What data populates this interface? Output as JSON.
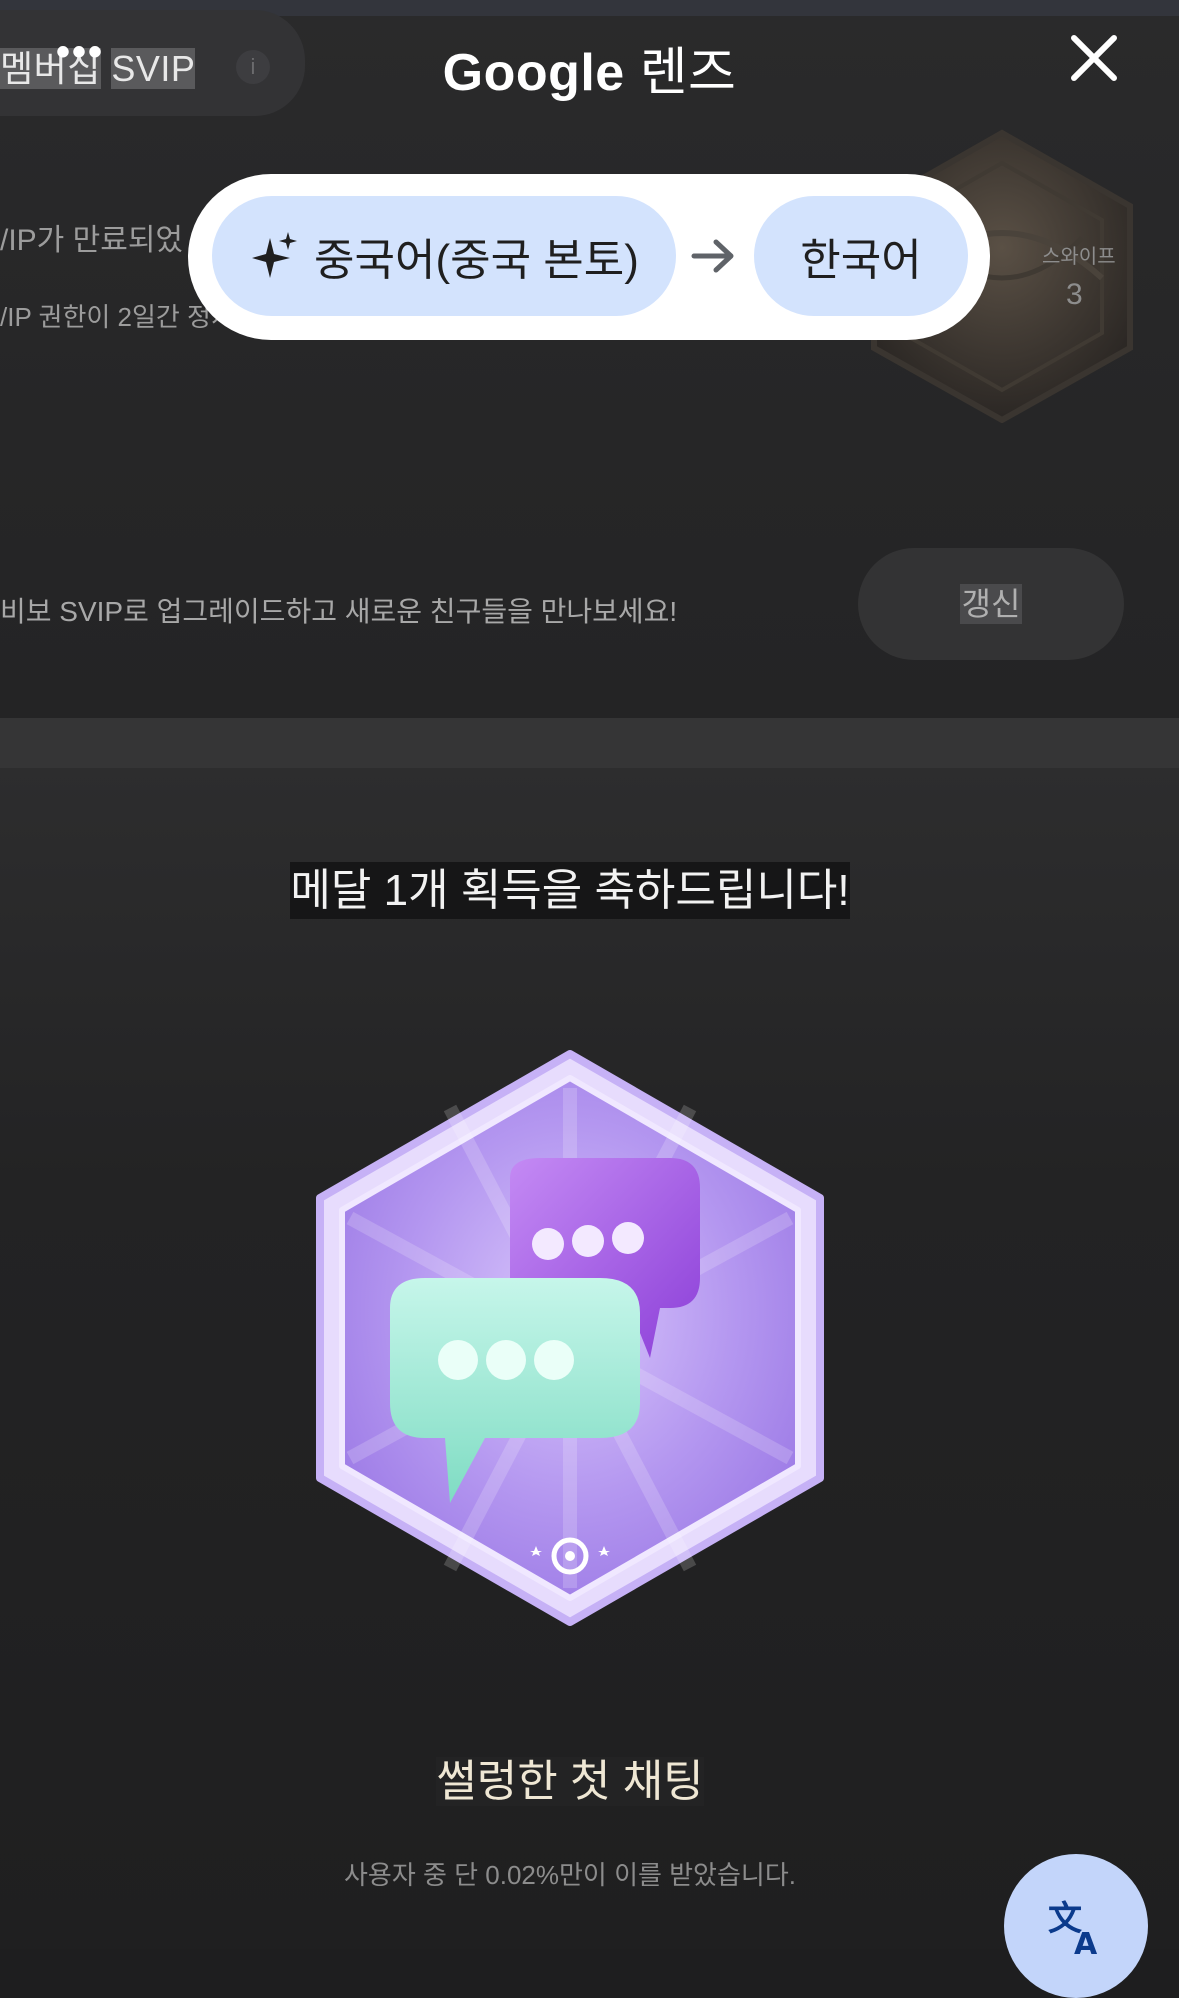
{
  "lens": {
    "brand": "Google",
    "product": "렌즈",
    "source_language": "중국어(중국 본토)",
    "target_language": "한국어",
    "close_icon": "close-icon",
    "sparkle_icon": "sparkle-icon",
    "arrow_icon": "arrow-right-icon",
    "translate_icon": "translate-icon"
  },
  "header": {
    "membership_prefix": "멤버십",
    "membership_tier": "SVIP",
    "more_icon": "more-dots-icon",
    "info_icon": "info-icon"
  },
  "membership": {
    "expired_text": "/IP가 만료되었",
    "rights_text": "/IP 권한이 2일간 정지",
    "swipe_label": "스와이프",
    "swipe_count": "3"
  },
  "upgrade": {
    "text": "비보 SVIP로 업그레이드하고 새로운 친구들을 만나보세요!",
    "renew_button": "갱신"
  },
  "achievement": {
    "congrats": "메달 1개 획득을 축하드립니다!",
    "badge_name": "썰렁한 첫 채팅",
    "badge_stat": "사용자 중 단 0.02%만이 이를 받았습니다."
  },
  "colors": {
    "background": "#1e1e1f",
    "lens_pill": "#d3e3fd",
    "fab": "#c3d5fa",
    "medal_purple": "#b79cf2",
    "chat_bubble_mint": "#8fe6cf",
    "chat_bubble_purple": "#a561e6"
  }
}
